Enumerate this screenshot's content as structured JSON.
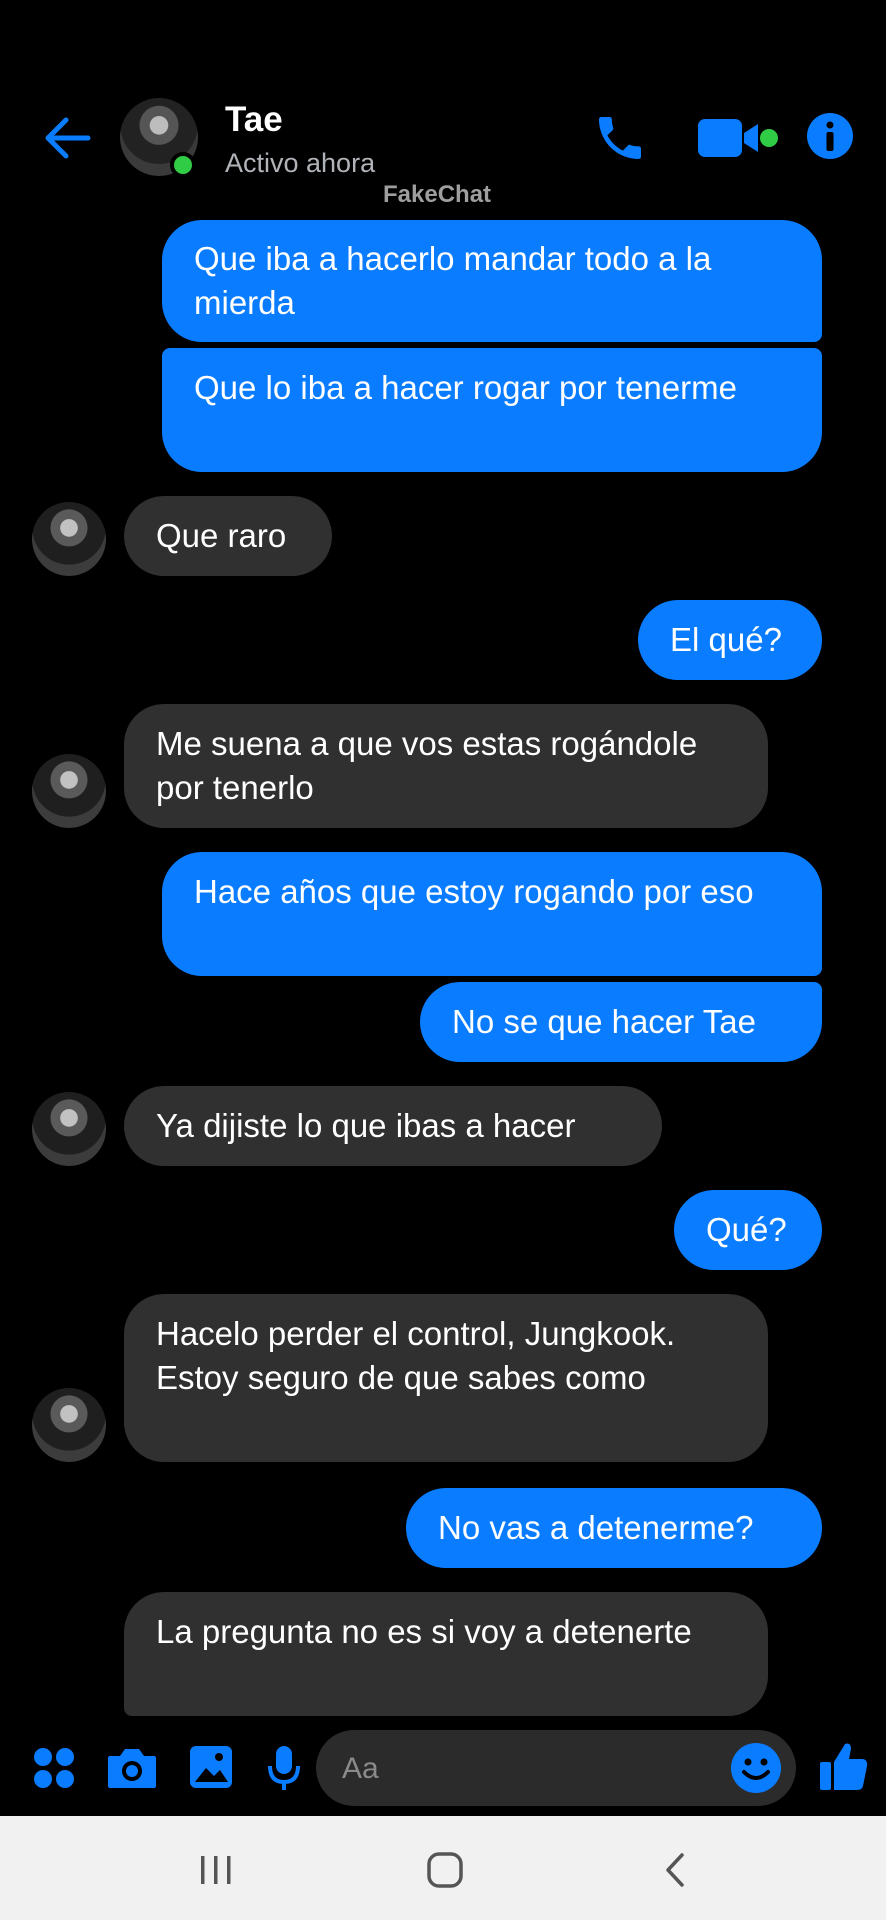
{
  "header": {
    "contact_name": "Tae",
    "status": "Activo ahora",
    "watermark": "FakeChat"
  },
  "messages": [
    {
      "side": "out",
      "text": "Que iba a hacerlo mandar todo a la mierda"
    },
    {
      "side": "out",
      "text": "Que lo iba a hacer rogar por tenerme"
    },
    {
      "side": "in",
      "text": "Que raro"
    },
    {
      "side": "out",
      "text": "El qué?"
    },
    {
      "side": "in",
      "text": "Me suena a que vos estas rogándole por tenerlo"
    },
    {
      "side": "out",
      "text": "Hace años que estoy rogando por eso"
    },
    {
      "side": "out",
      "text": "No se que hacer Tae"
    },
    {
      "side": "in",
      "text": "Ya dijiste lo que ibas a hacer"
    },
    {
      "side": "out",
      "text": "Qué?"
    },
    {
      "side": "in",
      "text": "Hacelo perder el control, Jungkook. Estoy seguro de que sabes como"
    },
    {
      "side": "out",
      "text": "No vas a detenerme?"
    },
    {
      "side": "in",
      "text": "La pregunta no es si voy a detenerte"
    }
  ],
  "composer": {
    "placeholder": "Aa"
  },
  "colors": {
    "accent": "#0a7cff",
    "incoming_bubble": "#303030",
    "online": "#31cc46"
  },
  "icons": [
    "back-arrow-icon",
    "phone-icon",
    "video-camera-icon",
    "info-icon",
    "apps-icon",
    "camera-icon",
    "gallery-icon",
    "microphone-icon",
    "emoji-icon",
    "thumbs-up-icon",
    "recent-apps-icon",
    "home-icon",
    "nav-back-icon"
  ]
}
